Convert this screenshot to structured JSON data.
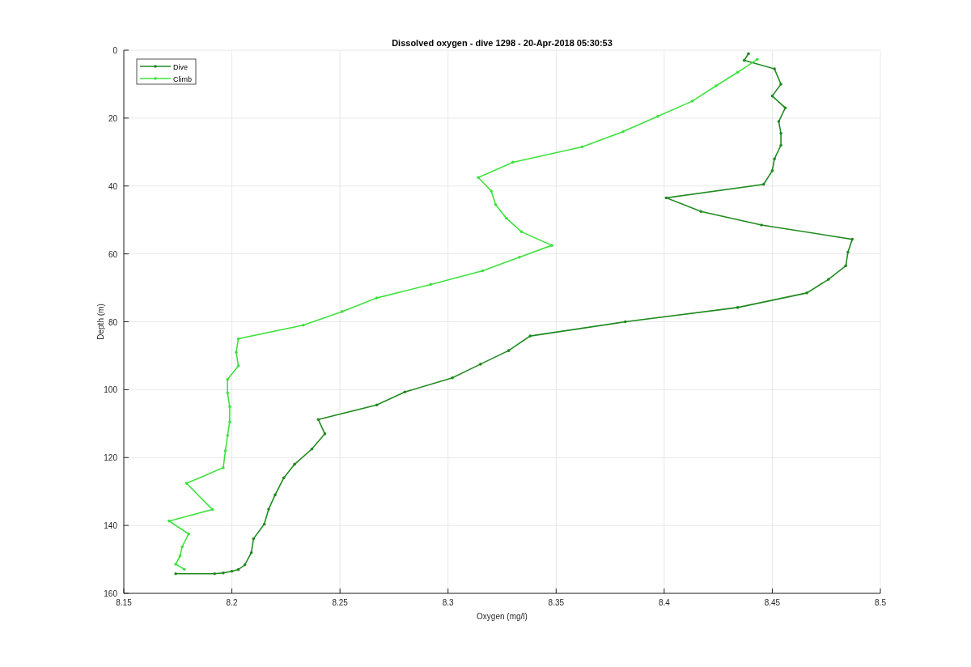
{
  "figure": {
    "chart_data": {
      "type": "line",
      "title": "Dissolved oxygen - dive 1298 - 20-Apr-2018 05:30:53",
      "xlabel": "Oxygen (mg/l)",
      "ylabel": "Depth (m)",
      "xlim": [
        8.15,
        8.5
      ],
      "ylim": [
        160,
        0
      ],
      "xticks": [
        8.15,
        8.2,
        8.25,
        8.3,
        8.35,
        8.4,
        8.45,
        8.5
      ],
      "yticks": [
        0,
        20,
        40,
        60,
        80,
        100,
        120,
        140,
        160
      ],
      "grid": true,
      "legend": "upper left",
      "series": [
        {
          "name": "Dive",
          "color": "#1f8a1f",
          "x": [
            8.439,
            8.437,
            8.451,
            8.454,
            8.45,
            8.456,
            8.453,
            8.454,
            8.454,
            8.451,
            8.45,
            8.446,
            8.401,
            8.417,
            8.445,
            8.487,
            8.485,
            8.484,
            8.476,
            8.466,
            8.434,
            8.382,
            8.338,
            8.328,
            8.315,
            8.302,
            8.28,
            8.267,
            8.24,
            8.243,
            8.237,
            8.229,
            8.224,
            8.22,
            8.217,
            8.215,
            8.21,
            8.209,
            8.206,
            8.203,
            8.2,
            8.196,
            8.192,
            8.174
          ],
          "values": [
            1,
            3,
            5.5,
            10,
            13.5,
            17,
            21,
            24.5,
            28,
            32,
            35.5,
            39.5,
            43.5,
            47.5,
            51.5,
            55.7,
            59.5,
            63.5,
            67.5,
            71.5,
            75.8,
            80,
            84.2,
            88.5,
            92.5,
            96.5,
            100.7,
            104.5,
            108.8,
            113,
            117.5,
            122,
            126,
            131,
            135.2,
            139.6,
            143.9,
            148,
            151.6,
            153,
            153.5,
            154,
            154.2,
            154.2
          ]
        },
        {
          "name": "Climb",
          "color": "#3ee23e",
          "x": [
            8.443,
            8.434,
            8.424,
            8.413,
            8.397,
            8.381,
            8.362,
            8.33,
            8.314,
            8.32,
            8.322,
            8.327,
            8.334,
            8.348,
            8.333,
            8.316,
            8.292,
            8.267,
            8.251,
            8.233,
            8.203,
            8.202,
            8.203,
            8.198,
            8.198,
            8.199,
            8.199,
            8.198,
            8.197,
            8.196,
            8.179,
            8.191,
            8.171,
            8.18,
            8.177,
            8.176,
            8.174,
            8.178
          ],
          "values": [
            2.7,
            6.5,
            10.5,
            15,
            19.5,
            24,
            28.5,
            33,
            37.5,
            41.5,
            45.5,
            49.5,
            53.5,
            57.5,
            61,
            65,
            69,
            73,
            77,
            81,
            85,
            89,
            93,
            97,
            101,
            105,
            109.5,
            113.5,
            118,
            123,
            127.6,
            135.3,
            138.7,
            142.5,
            146.3,
            149,
            151.4,
            152.9
          ]
        }
      ]
    }
  }
}
